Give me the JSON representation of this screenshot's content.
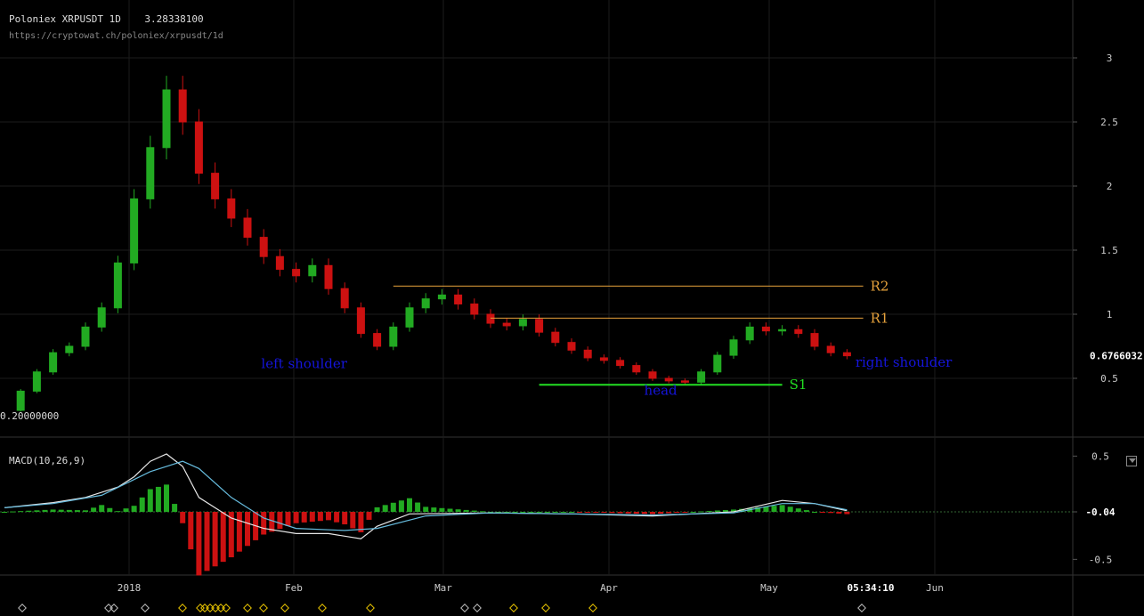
{
  "header": {
    "title": "Poloniex XRPUSDT 1D",
    "high_value": "3.28338100",
    "url": "https://cryptowat.ch/poloniex/xrpusdt/1d",
    "low_value": "0.20000000"
  },
  "chart_data": [
    {
      "type": "candlestick",
      "ylim": [
        0.2,
        3.28
      ],
      "yticks": [
        3,
        2.5,
        2,
        1.5,
        1,
        0.5
      ],
      "last_price_label": "0.6766032",
      "x_labels": [
        "2018",
        "Feb",
        "Mar",
        "Apr",
        "May",
        "Jun"
      ],
      "time_label": "05:34:10",
      "close_points": [
        [
          0,
          0.25
        ],
        [
          1,
          0.4
        ],
        [
          2,
          0.55
        ],
        [
          3,
          0.7
        ],
        [
          4,
          0.75
        ],
        [
          5,
          0.9
        ],
        [
          6,
          1.05
        ],
        [
          7,
          1.4
        ],
        [
          8,
          1.9
        ],
        [
          9,
          2.3
        ],
        [
          10,
          2.75
        ],
        [
          11,
          2.5
        ],
        [
          12,
          2.1
        ],
        [
          13,
          1.9
        ],
        [
          14,
          1.75
        ],
        [
          15,
          1.6
        ],
        [
          16,
          1.45
        ],
        [
          17,
          1.35
        ],
        [
          18,
          1.3
        ],
        [
          19,
          1.38
        ],
        [
          20,
          1.2
        ],
        [
          21,
          1.05
        ],
        [
          22,
          0.85
        ],
        [
          23,
          0.75
        ],
        [
          24,
          0.9
        ],
        [
          25,
          1.05
        ],
        [
          26,
          1.12
        ],
        [
          27,
          1.15
        ],
        [
          28,
          1.08
        ],
        [
          29,
          1.0
        ],
        [
          30,
          0.93
        ],
        [
          31,
          0.91
        ],
        [
          32,
          0.96
        ],
        [
          33,
          0.86
        ],
        [
          34,
          0.78
        ],
        [
          35,
          0.72
        ],
        [
          36,
          0.66
        ],
        [
          37,
          0.64
        ],
        [
          38,
          0.6
        ],
        [
          39,
          0.55
        ],
        [
          40,
          0.5
        ],
        [
          41,
          0.48
        ],
        [
          42,
          0.47
        ],
        [
          43,
          0.55
        ],
        [
          44,
          0.68
        ],
        [
          45,
          0.8
        ],
        [
          46,
          0.9
        ],
        [
          47,
          0.87
        ],
        [
          48,
          0.88
        ],
        [
          49,
          0.85
        ],
        [
          50,
          0.75
        ],
        [
          51,
          0.7
        ],
        [
          52,
          0.676
        ]
      ],
      "levels": [
        {
          "label": "R2",
          "value": 1.22,
          "from": 24,
          "to": 53,
          "color": "#e8a33c"
        },
        {
          "label": "R1",
          "value": 0.97,
          "from": 30,
          "to": 53,
          "color": "#e8a33c"
        },
        {
          "label": "S1",
          "value": 0.45,
          "from": 33,
          "to": 48,
          "color": "#22dd22"
        }
      ],
      "annotations": [
        {
          "text": "left shoulder",
          "x": 18.5,
          "y": 0.58,
          "color": "#1515dd"
        },
        {
          "text": "head",
          "x": 40.5,
          "y": 0.37,
          "color": "#1515dd"
        },
        {
          "text": "right shoulder",
          "x": 55.5,
          "y": 0.59,
          "color": "#1515dd"
        }
      ]
    },
    {
      "type": "macd",
      "title": "MACD(10,26,9)",
      "ylim": [
        -0.6,
        0.55
      ],
      "yticks": [
        "0.5",
        "-0.04",
        "-0.5"
      ],
      "macd_points": [
        [
          0,
          0
        ],
        [
          3,
          0.05
        ],
        [
          5,
          0.1
        ],
        [
          7,
          0.2
        ],
        [
          8,
          0.3
        ],
        [
          9,
          0.45
        ],
        [
          10,
          0.52
        ],
        [
          11,
          0.4
        ],
        [
          12,
          0.1
        ],
        [
          14,
          -0.1
        ],
        [
          16,
          -0.2
        ],
        [
          18,
          -0.25
        ],
        [
          20,
          -0.25
        ],
        [
          22,
          -0.3
        ],
        [
          23,
          -0.18
        ],
        [
          25,
          -0.06
        ],
        [
          30,
          -0.05
        ],
        [
          35,
          -0.06
        ],
        [
          40,
          -0.08
        ],
        [
          45,
          -0.04
        ],
        [
          48,
          0.07
        ],
        [
          50,
          0.04
        ],
        [
          52,
          -0.03
        ]
      ],
      "signal_points": [
        [
          0,
          0
        ],
        [
          3,
          0.04
        ],
        [
          6,
          0.12
        ],
        [
          9,
          0.35
        ],
        [
          11,
          0.45
        ],
        [
          12,
          0.38
        ],
        [
          14,
          0.1
        ],
        [
          16,
          -0.1
        ],
        [
          18,
          -0.2
        ],
        [
          21,
          -0.22
        ],
        [
          23,
          -0.2
        ],
        [
          26,
          -0.08
        ],
        [
          30,
          -0.05
        ],
        [
          40,
          -0.07
        ],
        [
          45,
          -0.05
        ],
        [
          48,
          0.04
        ],
        [
          50,
          0.04
        ],
        [
          52,
          -0.02
        ]
      ]
    }
  ],
  "colors": {
    "up": "#22aa22",
    "down": "#cc1111",
    "grid": "#1c1c1c",
    "macd_line": "#e6e6e6",
    "signal_line": "#66bbdd"
  }
}
